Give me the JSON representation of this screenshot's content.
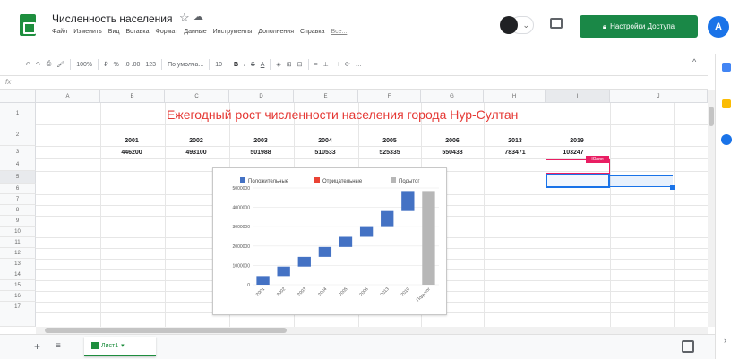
{
  "header": {
    "title": "Численность населения",
    "menu": [
      "Файл",
      "Изменить",
      "Вид",
      "Вставка",
      "Формат",
      "Данные",
      "Инструменты",
      "Дополнения",
      "Справка"
    ],
    "last_edit": "Все...",
    "share_label": "Настройки Доступа",
    "avatar_letter": "A",
    "presence_letter": "C"
  },
  "toolbar": {
    "zoom": "100%",
    "currency": "₽",
    "percent": "%",
    "decimals": ".0  .00",
    "number_format": "123",
    "font": "По умолча...",
    "font_size": "10",
    "bold": "B",
    "italic": "I",
    "strike": "S",
    "underline_a": "A"
  },
  "formula_bar": {
    "fx": "fx"
  },
  "columns": [
    "A",
    "B",
    "C",
    "D",
    "E",
    "F",
    "G",
    "H",
    "I",
    "J"
  ],
  "rows": [
    "1",
    "2",
    "3",
    "4",
    "5",
    "6",
    "7",
    "8",
    "9",
    "10",
    "11",
    "12",
    "13",
    "14",
    "15",
    "16",
    "17"
  ],
  "sheet": {
    "title": "Ежегодный рост численности населения города Нур-Султан",
    "years": [
      "2001",
      "2002",
      "2003",
      "2004",
      "2005",
      "2006",
      "2013",
      "2019"
    ],
    "populations": [
      "446200",
      "493100",
      "501988",
      "510533",
      "525335",
      "550438",
      "783471",
      "103247"
    ],
    "tag": "Юлия"
  },
  "chart_data": {
    "type": "waterfall",
    "legend": [
      "Положительные",
      "Отрицательные",
      "Подытог"
    ],
    "legend_position": "top",
    "colors": {
      "positive": "#4472c4",
      "negative": "#ea4335",
      "subtotal": "#b7b7b7"
    },
    "categories": [
      "2001",
      "2002",
      "2003",
      "2004",
      "2005",
      "2006",
      "2013",
      "2019",
      "Подытог"
    ],
    "increments": [
      446200,
      493100,
      501988,
      510533,
      525335,
      550438,
      783471,
      1032475
    ],
    "subtotal": 4843540,
    "y_ticks": [
      "0",
      "1000000",
      "2000000",
      "3000000",
      "4000000",
      "5000000"
    ],
    "ylim": [
      0,
      5000000
    ]
  },
  "bottom": {
    "sheet_tab": "Лист1"
  }
}
